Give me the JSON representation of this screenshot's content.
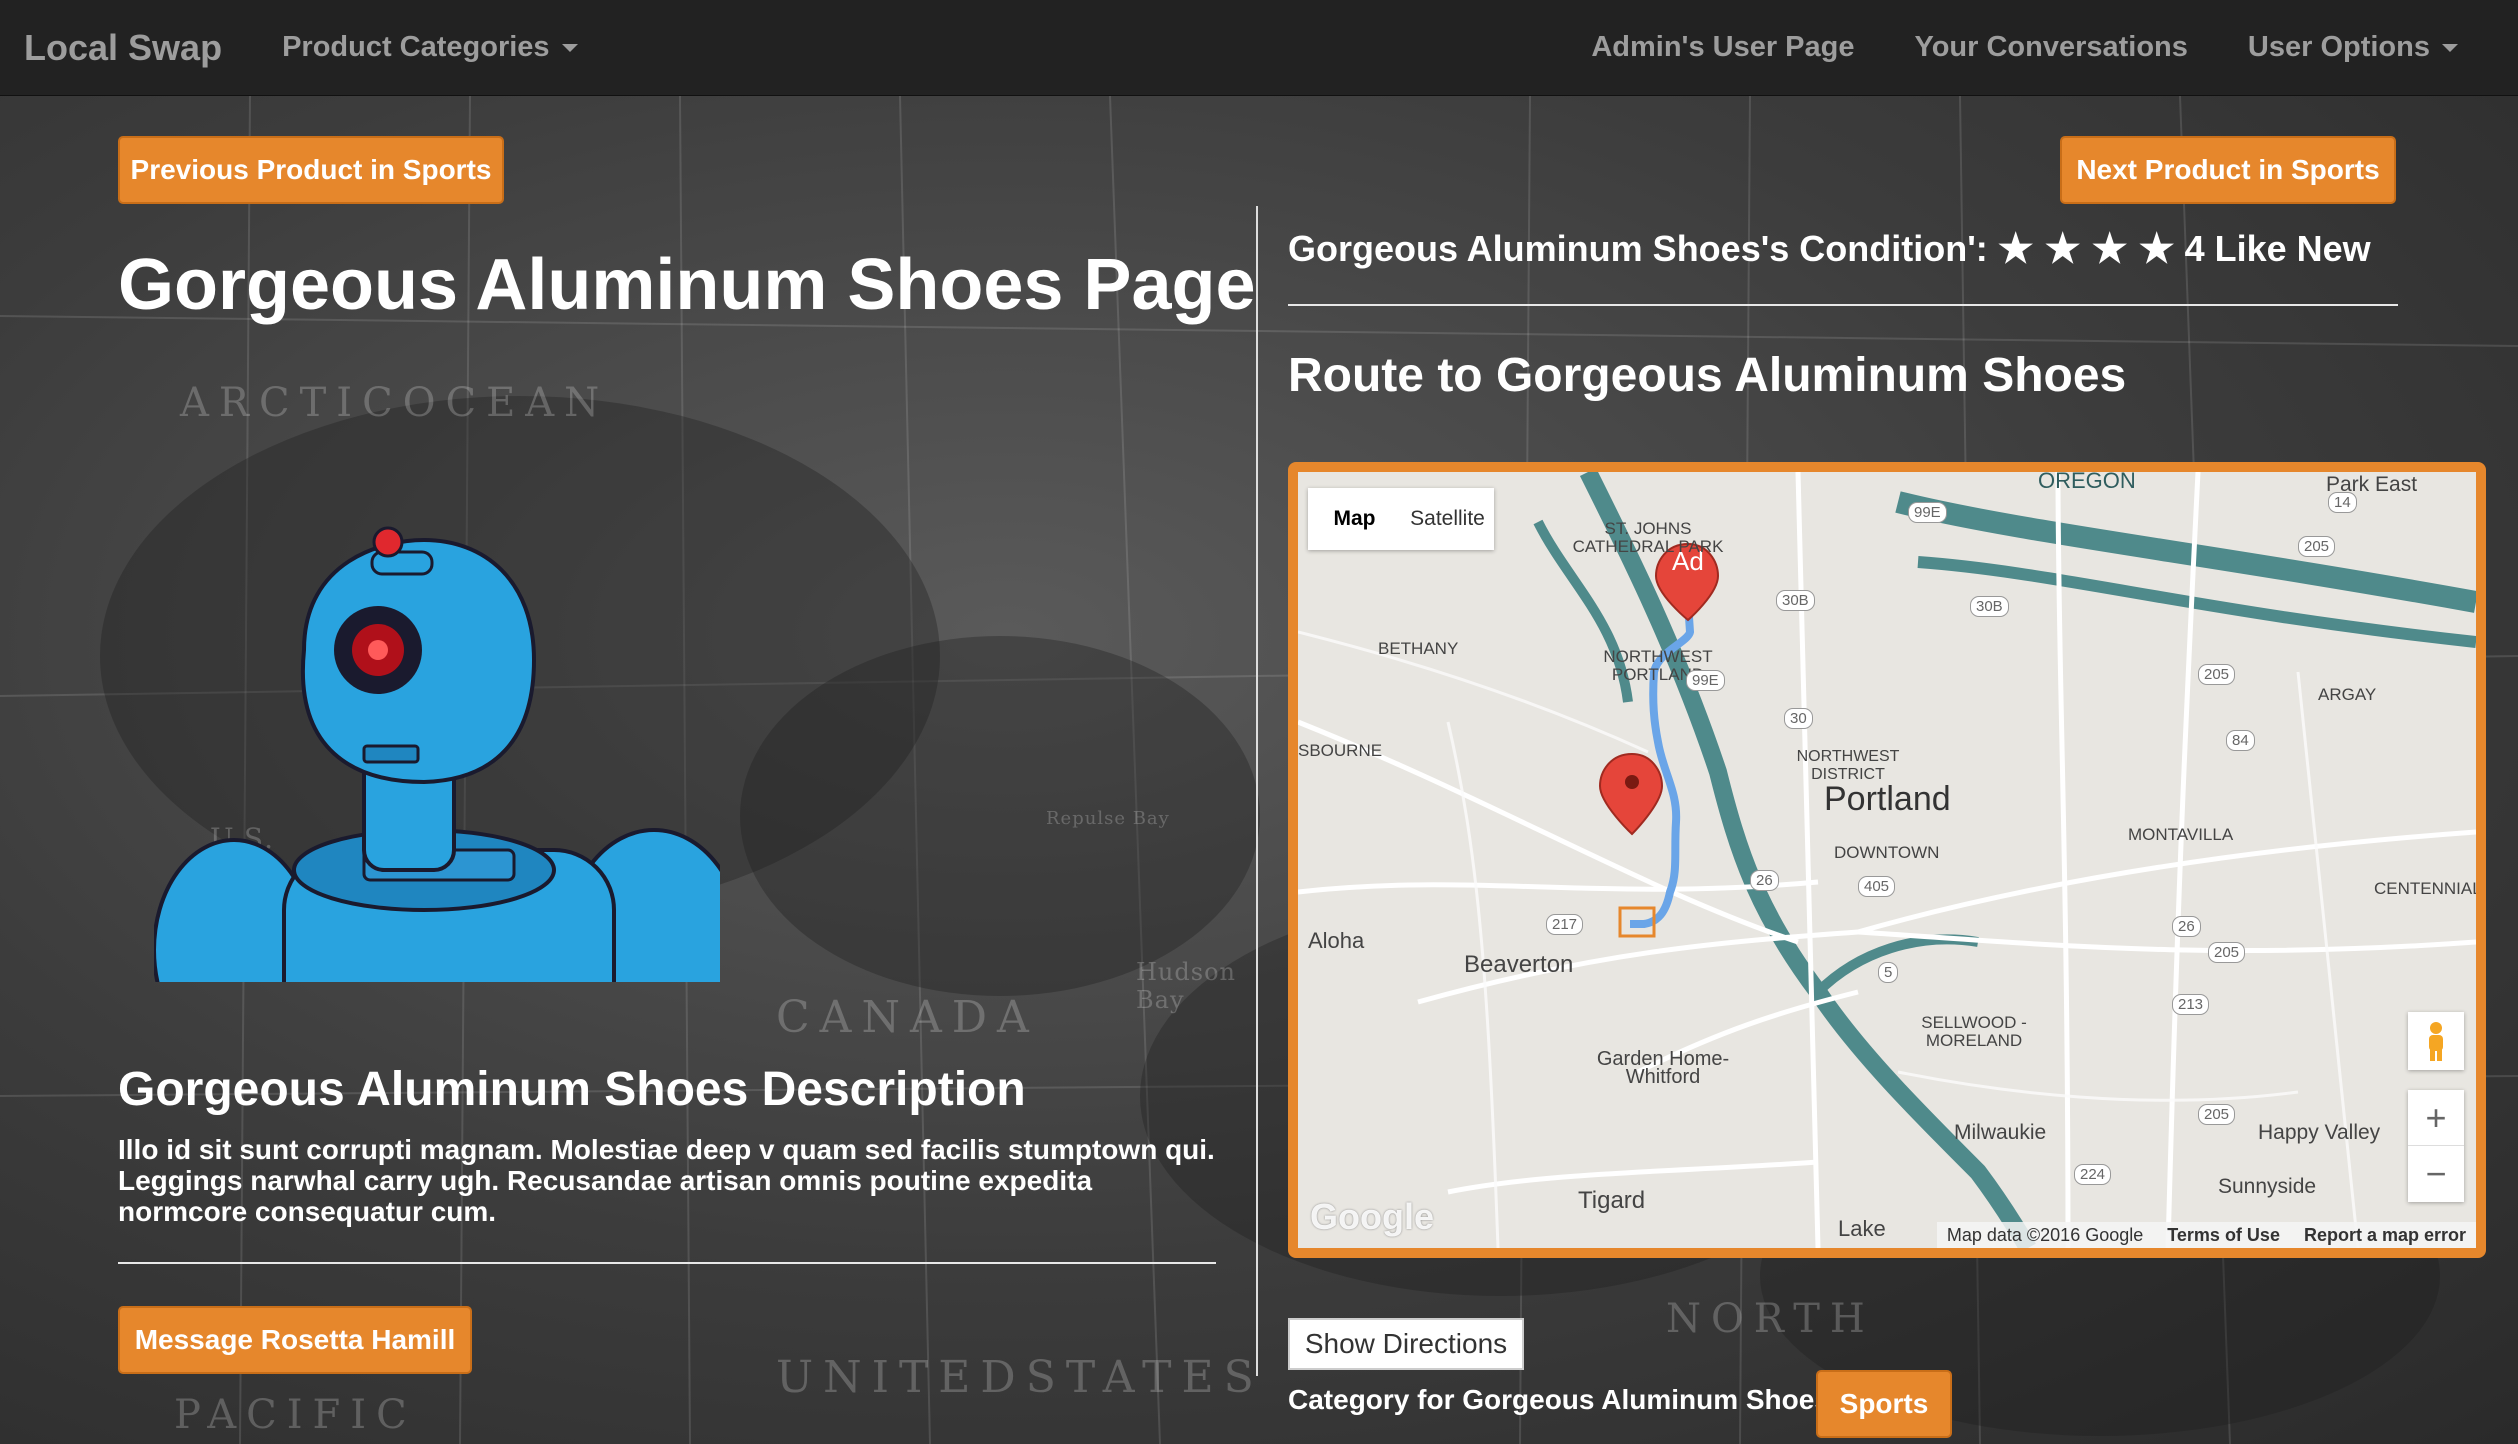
{
  "nav": {
    "brand": "Local Swap",
    "categories": "Product Categories",
    "admin": "Admin's User Page",
    "conversations": "Your Conversations",
    "user_options": "User Options"
  },
  "buttons": {
    "prev": "Previous Product in Sports",
    "next": "Next Product in Sports",
    "message": "Message Rosetta Hamill",
    "show_directions": "Show Directions",
    "category": "Sports"
  },
  "product": {
    "title": "Gorgeous Aluminum Shoes Page",
    "condition_label": "Gorgeous Aluminum Shoes's Condition':",
    "stars": "★ ★ ★ ★",
    "condition_value": "4 Like New",
    "route_title": "Route to Gorgeous Aluminum Shoes",
    "desc_title": "Gorgeous Aluminum Shoes Description",
    "desc_text": "Illo id sit sunt corrupti magnam. Molestiae deep v quam sed facilis stumptown qui. Leggings narwhal carry ugh. Recusandae artisan omnis poutine expedita normcore consequatur cum.",
    "category_label": "Category for Gorgeous Aluminum Shoes"
  },
  "background_labels": {
    "arctic": "ARCTICOCEAN",
    "canada": "CANADA",
    "us": "UNITEDSTATES",
    "pacific": "PACIFIC",
    "north": "NORTH",
    "us_short": "U.S.",
    "hudson": "Hudson Bay",
    "repulse": "Repulse Bay"
  },
  "map": {
    "map_tab": "Map",
    "satellite_tab": "Satellite",
    "portland": "Portland",
    "downtown": "DOWNTOWN",
    "beaverton": "Beaverton",
    "tigard": "Tigard",
    "aloha": "Aloha",
    "milwaukie": "Milwaukie",
    "happy_valley": "Happy Valley",
    "sunnyside": "Sunnyside",
    "garden_home": "Garden Home-Whitford",
    "bethany": "BETHANY",
    "nw_portland": "NORTHWEST PORTLAND",
    "nw_district": "NORTHWEST DISTRICT",
    "st_johns": "ST. JOHNS CATHEDRAL PARK",
    "montavilla": "MONTAVILLA",
    "argay": "ARGAY",
    "park_east": "Park East",
    "centennial": "CENTENNIAL",
    "sellwood": "SELLWOOD - MORELAND",
    "sbourne": "SBOURNE",
    "oregon": "OREGON",
    "lake": "Lake",
    "marker_a": "Ad",
    "shields": [
      "99E",
      "30B",
      "30B",
      "30",
      "26",
      "217",
      "205",
      "205",
      "84",
      "26",
      "205",
      "213",
      "205",
      "224",
      "14",
      "405",
      "5",
      "99E"
    ],
    "zoom_in": "+",
    "zoom_out": "−",
    "google": "Google",
    "map_data": "Map data ©2016 Google",
    "terms": "Terms of Use",
    "report": "Report a map error"
  },
  "colors": {
    "accent": "#e6872c",
    "navbar": "#222222",
    "route": "#6aa5e8",
    "river": "#4f8a8b"
  }
}
